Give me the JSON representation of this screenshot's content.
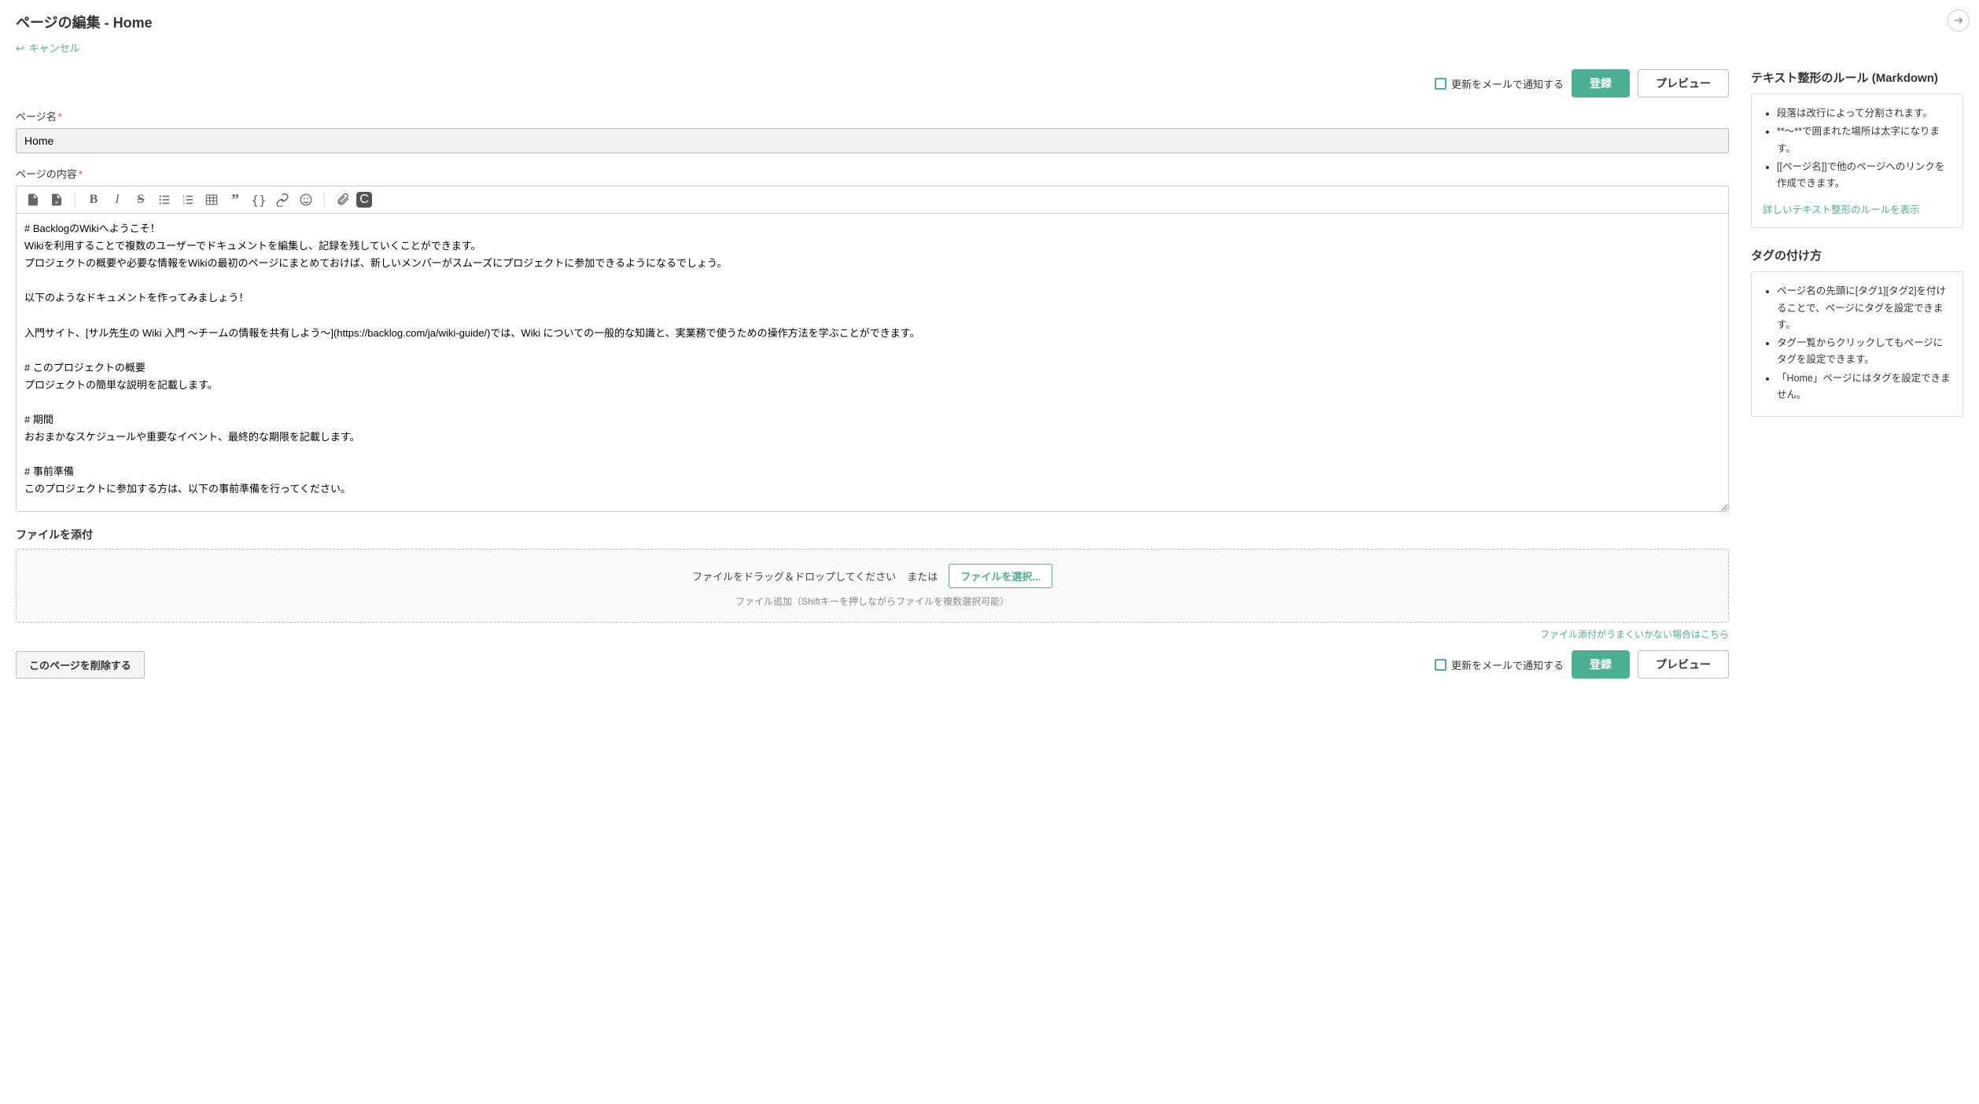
{
  "header": {
    "title": "ページの編集 - Home",
    "cancel": "キャンセル"
  },
  "actions": {
    "notify_label": "更新をメールで通知する",
    "submit": "登録",
    "preview": "プレビュー",
    "delete": "このページを削除する"
  },
  "page_name": {
    "label": "ページ名",
    "value": "Home"
  },
  "page_content": {
    "label": "ページの内容",
    "value": "# BacklogのWikiへようこそ！\nWikiを利用することで複数のユーザーでドキュメントを編集し、記録を残していくことができます。\nプロジェクトの概要や必要な情報をWikiの最初のページにまとめておけば、新しいメンバーがスムーズにプロジェクトに参加できるようになるでしょう。\n\n以下のようなドキュメントを作ってみましょう！\n\n入門サイト、[サル先生の Wiki 入門 〜チームの情報を共有しよう〜](https://backlog.com/ja/wiki-guide/)では、Wiki についての一般的な知識と、実業務で使うための操作方法を学ぶことができます。\n\n# このプロジェクトの概要\nプロジェクトの簡単な説明を記載します。\n\n# 期間\nおおまかなスケジュールや重要なイベント、最終的な期限を記載します。\n\n# 事前準備\nこのプロジェクトに参加する方は、以下の事前準備を行ってください。\n\n* 概要説明を受ける\n* 各種アカウントを発行する\n* 環境を構築する"
  },
  "attach": {
    "title": "ファイルを添付",
    "drag_text": "ファイルをドラッグ＆ドロップしてください",
    "or": "または",
    "select_btn": "ファイルを選択...",
    "hint": "ファイル追加（Shiftキーを押しながらファイルを複数選択可能）",
    "help_link": "ファイル添付がうまくいかない場合はこちら"
  },
  "sidebar": {
    "rules_title": "テキスト整形のルール (Markdown)",
    "rules": [
      "段落は改行によって分割されます。",
      "**〜**で囲まれた場所は太字になります。",
      "[[ページ名]]で他のページへのリンクを作成できます。"
    ],
    "rules_more": "詳しいテキスト整形のルールを表示",
    "tags_title": "タグの付け方",
    "tags": [
      "ページ名の先頭に[タグ1][タグ2]を付けることで、ページにタグを設定できます。",
      "タグ一覧からクリックしてもページにタグを設定できます。",
      "「Home」ページにはタグを設定できません。"
    ]
  }
}
